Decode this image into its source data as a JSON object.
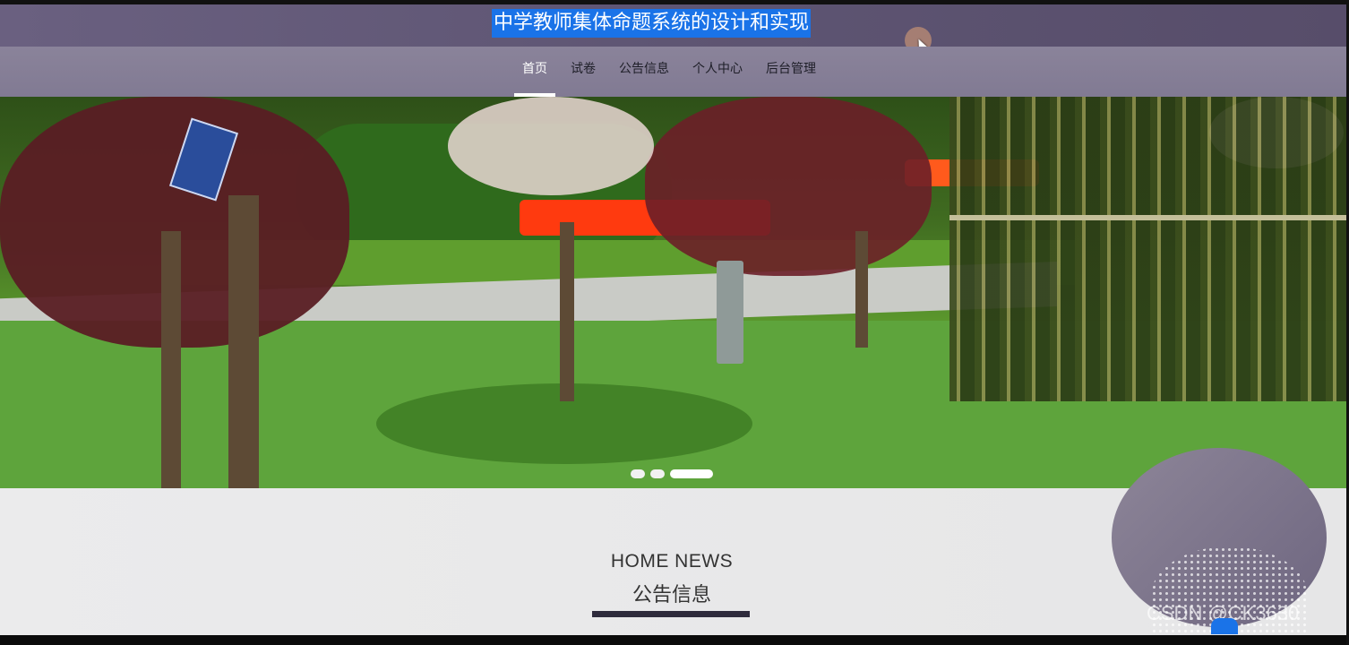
{
  "header": {
    "site_title": "中学教师集体命题系统的设计和实现"
  },
  "nav": {
    "items": [
      {
        "label": "首页",
        "active": true
      },
      {
        "label": "试卷",
        "active": false
      },
      {
        "label": "公告信息",
        "active": false
      },
      {
        "label": "个人中心",
        "active": false
      },
      {
        "label": "后台管理",
        "active": false
      }
    ]
  },
  "carousel": {
    "slide_count": 3,
    "active_index": 2
  },
  "news_section": {
    "heading_en": "HOME NEWS",
    "heading_cn": "公告信息"
  },
  "watermark": "CSDN @CK3630",
  "colors": {
    "header_bg": "#5e5573",
    "nav_bg": "#8a839a",
    "title_highlight": "#1a73e8",
    "accent_dark": "#2e2b3c"
  }
}
